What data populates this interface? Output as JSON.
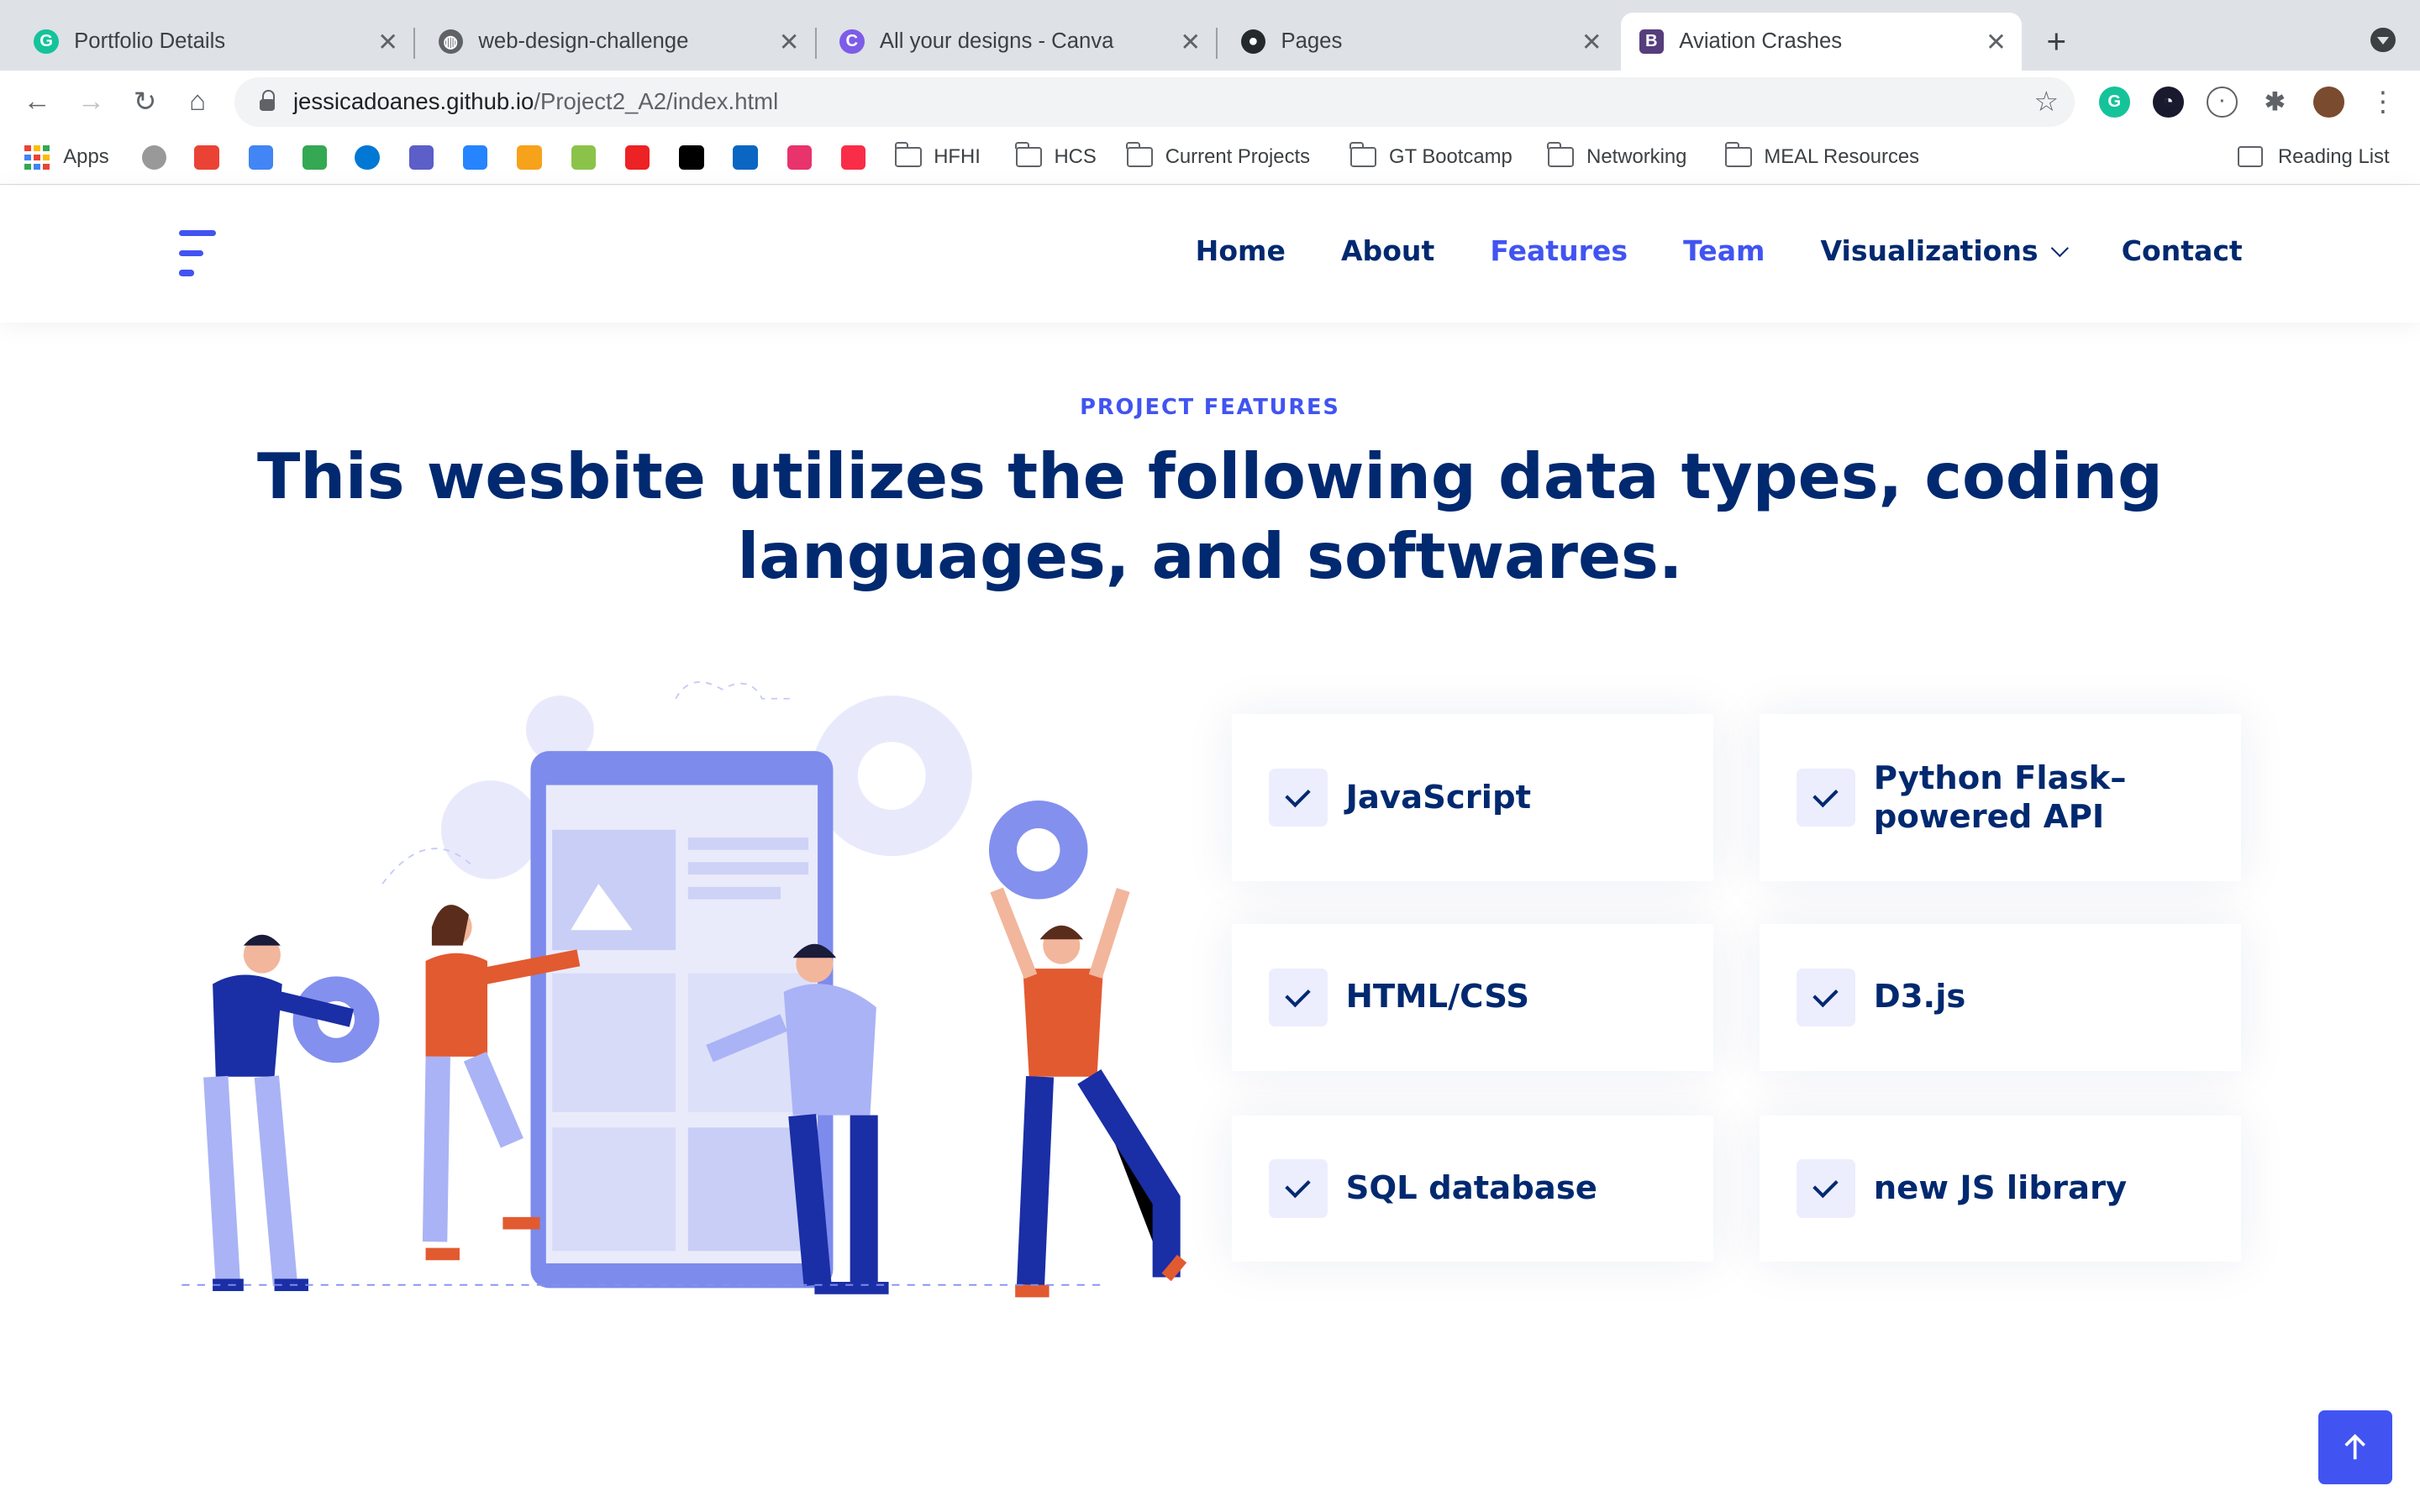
{
  "browser": {
    "tabs": [
      {
        "title": "Portfolio Details",
        "icon": "grammarly-icon",
        "color": "#15c39a"
      },
      {
        "title": "web-design-challenge",
        "icon": "globe-icon",
        "color": "#5f6368"
      },
      {
        "title": "All your designs - Canva",
        "icon": "canva-icon",
        "color": "#7d5ce8"
      },
      {
        "title": "Pages",
        "icon": "github-icon",
        "color": "#24292e"
      },
      {
        "title": "Aviation Crashes",
        "icon": "bootstrap-icon",
        "color": "#563d7c"
      }
    ],
    "url_host": "jessicadoanes.github.io",
    "url_path": "/Project2_A2/index.html",
    "bookmarks": {
      "apps": "Apps",
      "folders": [
        "HFHI",
        "HCS",
        "Current Projects",
        "GT Bootcamp",
        "Networking",
        "MEAL Resources"
      ],
      "reading_list": "Reading List"
    }
  },
  "site": {
    "nav": [
      "Home",
      "About",
      "Features",
      "Team",
      "Visualizations",
      "Contact"
    ],
    "active_nav": [
      "Features",
      "Team"
    ],
    "kicker": "PROJECT FEATURES",
    "heading": "This wesbite utilizes the following data types, coding languages, and softwares.",
    "features": [
      "JavaScript",
      "Python Flask–powered API",
      "HTML/CSS",
      "D3.js",
      "SQL database",
      "new JS library"
    ],
    "accent_color": "#4154f1",
    "heading_color": "#012970"
  }
}
